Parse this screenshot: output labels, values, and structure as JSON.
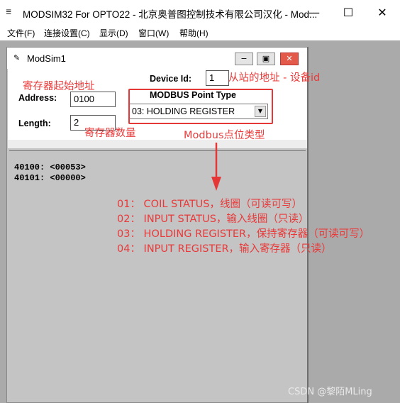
{
  "window": {
    "app_icon": "☰",
    "title": "MODSIM32 For OPTO22 - 北京奥普图控制技术有限公司汉化 - Mod...",
    "minimize": "—",
    "maximize": "☐",
    "close": "✕"
  },
  "menu": {
    "items": [
      {
        "label": "文件(F)"
      },
      {
        "label": "连接设置(C)"
      },
      {
        "label": "显示(D)"
      },
      {
        "label": "窗口(W)"
      },
      {
        "label": "帮助(H)"
      }
    ]
  },
  "child": {
    "title": "ModSim1",
    "minimize": "−",
    "restore": "▣",
    "close": "✕"
  },
  "form": {
    "device_id_label": "Device Id:",
    "device_id_value": "1",
    "point_type_label": "MODBUS Point Type",
    "point_type_value": "03: HOLDING REGISTER",
    "address_label": "Address:",
    "address_value": "0100",
    "length_label": "Length:",
    "length_value": "2"
  },
  "registers": [
    "40100: <00053>",
    "40101: <00000>"
  ],
  "annotations": {
    "start_address": "寄存器起始地址",
    "slave_id": "从站的地址 - 设备id",
    "register_count": "寄存器数量",
    "point_type": "Modbus点位类型",
    "type_list": [
      "01： COIL STATUS，线圈（可读可写）",
      "02： INPUT STATUS，输入线圈（只读）",
      "03： HOLDING REGISTER，保持寄存器（可读可写）",
      "04： INPUT REGISTER，输入寄存器（只读）"
    ],
    "color": "#e83a3a"
  },
  "watermark": "CSDN @黎陌MLing"
}
